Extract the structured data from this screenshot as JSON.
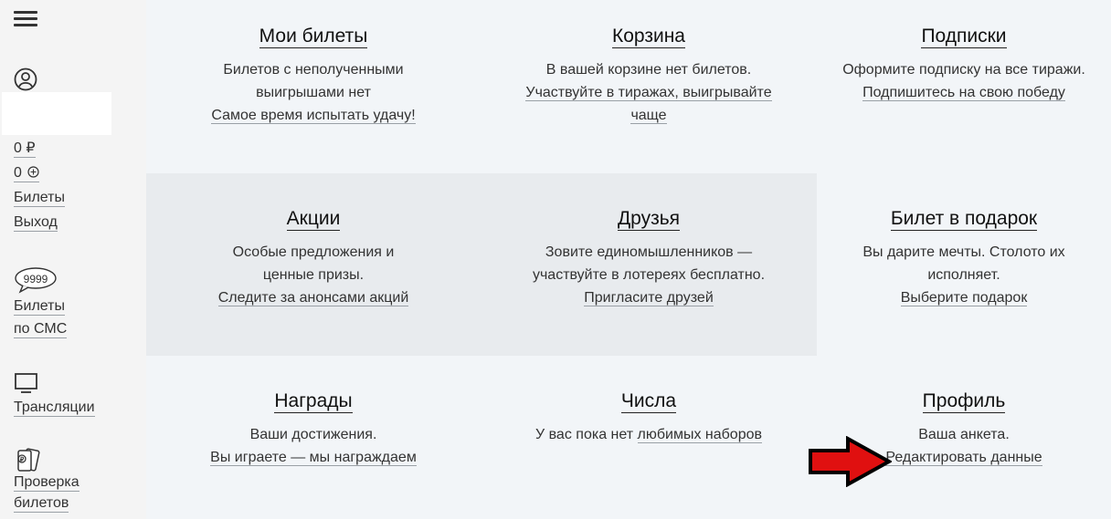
{
  "sidebar": {
    "balance": "0 ₽",
    "bonus": "0",
    "tickets_label": "Билеты",
    "logout_label": "Выход",
    "sms_badge": "9999",
    "sms_line1": "Билеты",
    "sms_line2": "по СМС",
    "broadcasts_label": "Трансляции",
    "check_line1": "Проверка",
    "check_line2": "билетов"
  },
  "tiles": [
    {
      "title": "Мои билеты",
      "line1": "Билетов с неполученными",
      "line2": "выигрышами нет",
      "link": "Самое время испытать удачу!"
    },
    {
      "title": "Корзина",
      "line1": "В вашей корзине нет билетов.",
      "link1": "Участвуйте в тиражах, выигрывайте",
      "link2": "чаще"
    },
    {
      "title": "Подписки",
      "line1": "Оформите подписку на все тиражи.",
      "link": "Подпишитесь на свою победу"
    },
    {
      "title": "Акции",
      "line1": "Особые предложения и",
      "line2": "ценные призы.",
      "link": "Следите за анонсами акций"
    },
    {
      "title": "Друзья",
      "line1": "Зовите единомышленников —",
      "line2": "участвуйте в лотереях бесплатно.",
      "link": "Пригласите друзей"
    },
    {
      "title": "Билет в подарок",
      "line1": "Вы дарите мечты. Столото их",
      "line2": "исполняет.",
      "link": "Выберите подарок"
    },
    {
      "title": "Награды",
      "line1": "Ваши достижения.",
      "link": "Вы играете — мы награждаем"
    },
    {
      "title": "Числа",
      "text": "У вас пока нет ",
      "link": "любимых наборов"
    },
    {
      "title": "Профиль",
      "line1": "Ваша анкета.",
      "link": "Редактировать данные"
    }
  ],
  "colors": {
    "sidebar_bg": "#f4f4f4",
    "tile_light": "#f2f5f8",
    "tile_dark": "#e8ebee",
    "arrow": "#e01010"
  }
}
